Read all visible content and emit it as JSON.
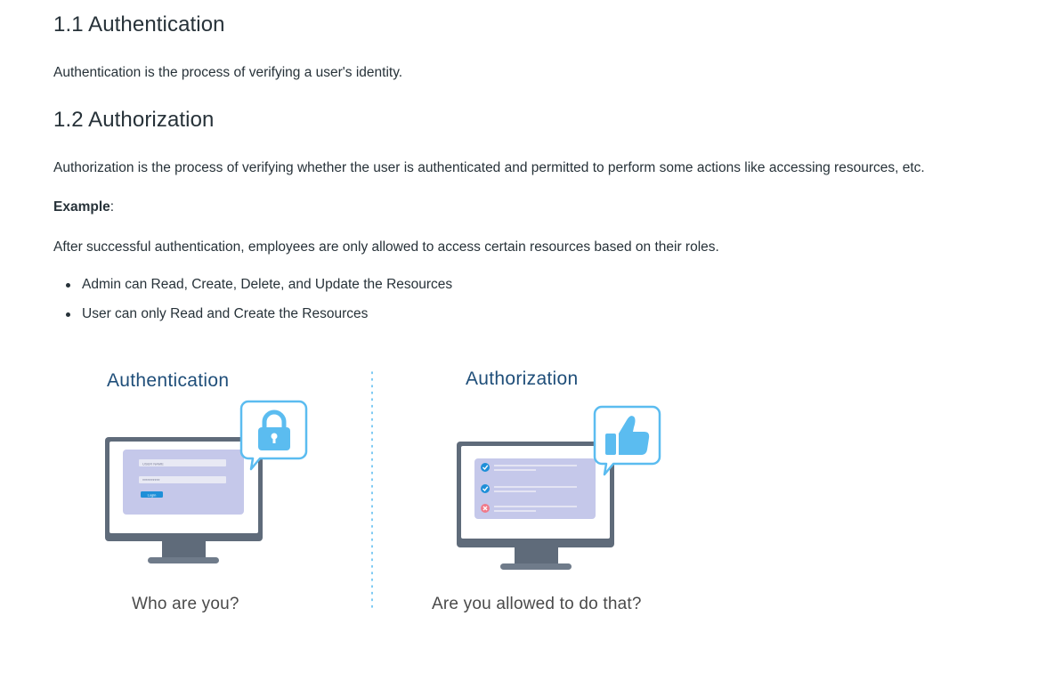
{
  "sections": [
    {
      "heading": "1.1 Authentication",
      "text": "Authentication is the process of verifying a user's identity."
    },
    {
      "heading": "1.2 Authorization",
      "text": "Authorization is the process of verifying whether the user is authenticated and permitted to perform some actions like accessing resources, etc."
    }
  ],
  "example": {
    "label": "Example",
    "suffix": ":",
    "text": "After successful authentication, employees are only allowed to access certain resources based on their roles.",
    "bullets": [
      "Admin can Read, Create, Delete, and Update the Resources",
      "User can only Read and Create the Resources"
    ]
  },
  "illustration": {
    "left": {
      "title": "Authentication",
      "caption": "Who are you?",
      "username_label": "USER NAME",
      "password_mask": "**********",
      "login_label": "Login",
      "badge_icon": "lock-icon"
    },
    "right": {
      "title": "Authorization",
      "caption": "Are you allowed to do that?",
      "badge_icon": "thumbs-up-icon"
    },
    "colors": {
      "title": "#1f4e79",
      "monitor": "#5f6b7a",
      "screen_panel": "#c5c8ea",
      "badge": "#5bbcf0",
      "check": "#1e8fd8",
      "cross": "#f07a8a",
      "divider": "#5bbcf0"
    }
  }
}
